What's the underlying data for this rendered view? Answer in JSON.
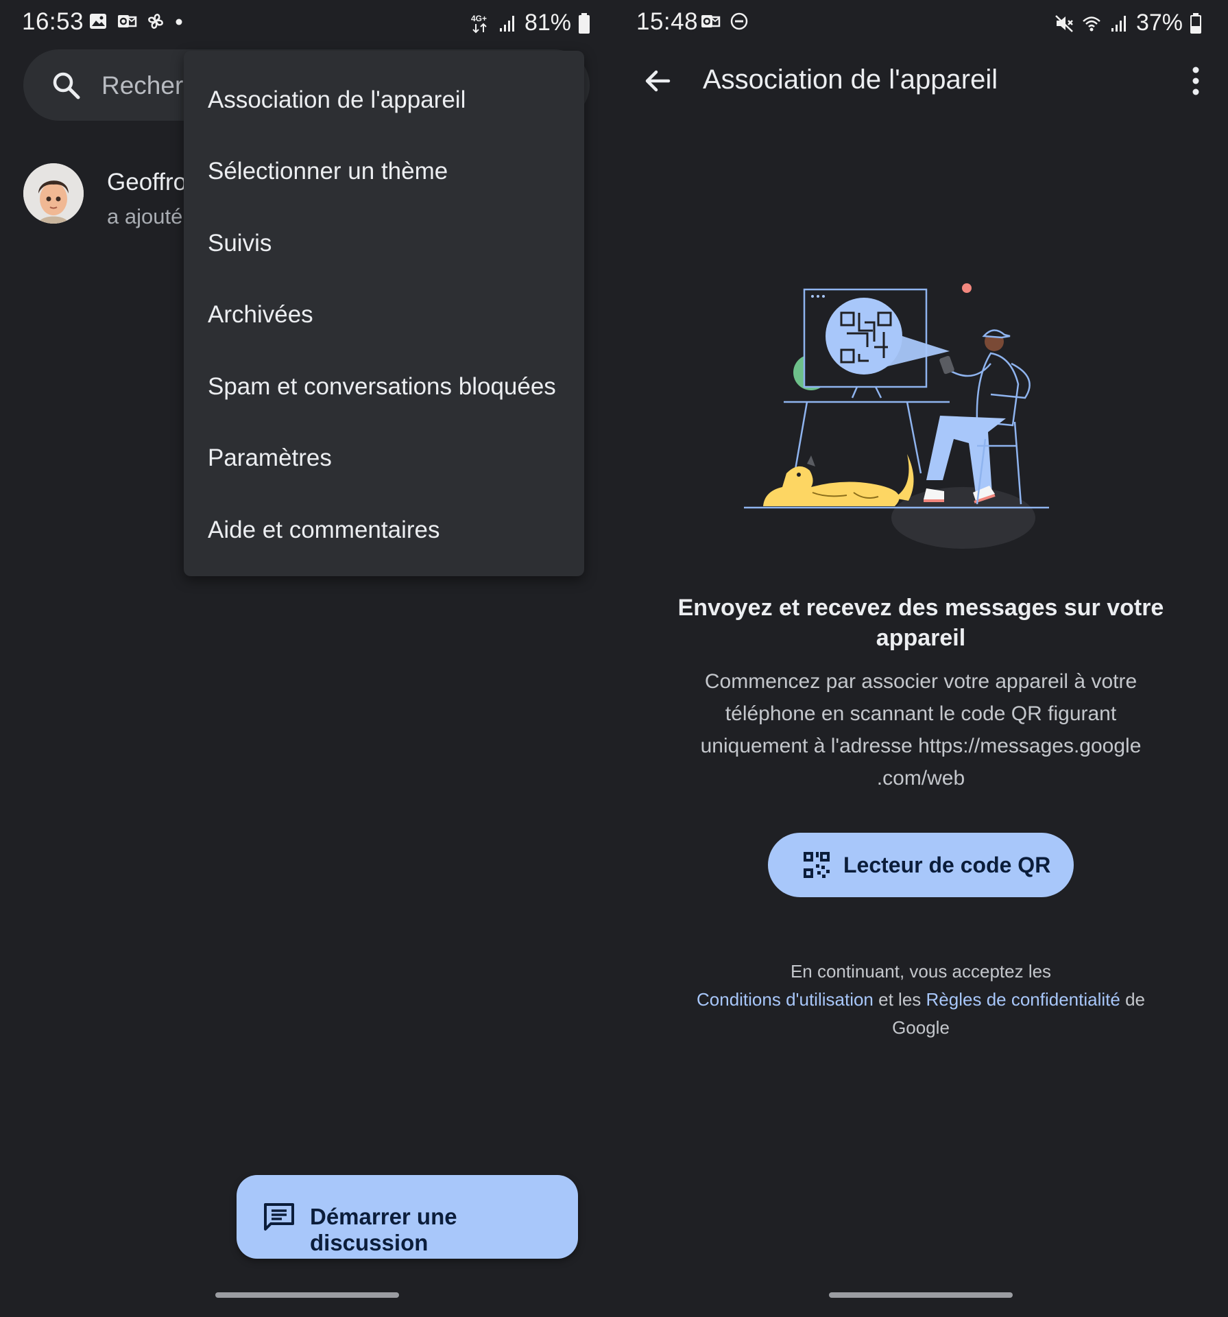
{
  "left": {
    "status": {
      "time": "16:53",
      "network": "4G+",
      "battery": "81%"
    },
    "search": {
      "placeholder": "Recherc"
    },
    "conversation": {
      "name": "Geoffro",
      "preview": "a ajouté"
    },
    "menu": {
      "items": [
        "Association de l'appareil",
        "Sélectionner un thème",
        "Suivis",
        "Archivées",
        "Spam et conversations bloquées",
        "Paramètres",
        "Aide et commentaires"
      ]
    },
    "fab": {
      "label": "Démarrer une discussion"
    }
  },
  "right": {
    "status": {
      "time": "15:48",
      "battery": "37%"
    },
    "appbar": {
      "title": "Association de l'appareil"
    },
    "heading": "Envoyez et recevez des messages sur votre appareil",
    "body": "Commencez par associer votre appareil à votre téléphone en scannant le code QR figurant uniquement à l'adresse https://messages.google .com/web",
    "qr_button": {
      "label": "Lecteur de code QR"
    },
    "legal": {
      "prefix": "En continuant, vous acceptez les",
      "terms_link": "Conditions d'utilisation",
      "middle": "et les",
      "privacy_link": "Règles de confidentialité",
      "suffix": "de Google"
    }
  },
  "colors": {
    "background": "#1f2024",
    "surface": "#2d2f33",
    "accent": "#a8c7fa",
    "on_accent": "#0b1d3a",
    "link": "#a8c7fa"
  },
  "icons": {
    "left_status": [
      "gallery-icon",
      "outlook-icon",
      "pinwheel-icon",
      "dot-icon"
    ],
    "left_status_right": [
      "signal-4g-icon",
      "signal-bars-icon",
      "battery-icon"
    ],
    "right_status": [
      "outlook-icon",
      "do-not-disturb-icon"
    ],
    "right_status_right": [
      "mute-icon",
      "wifi-icon",
      "signal-bars-icon",
      "battery-icon"
    ]
  }
}
